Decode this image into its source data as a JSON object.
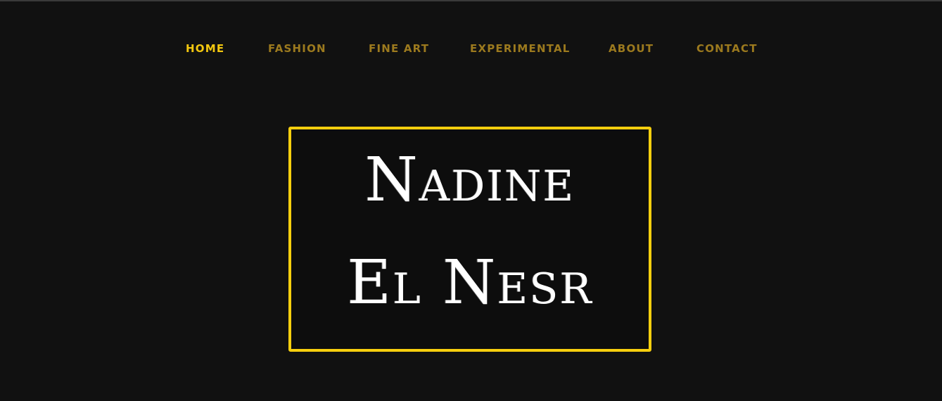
{
  "nav": {
    "items": [
      {
        "label": "HOME",
        "active": true
      },
      {
        "label": "FASHION",
        "active": false
      },
      {
        "label": "FINE ART",
        "active": false
      },
      {
        "label": "EXPERIMENTAL",
        "active": false
      },
      {
        "label": "ABOUT",
        "active": false
      },
      {
        "label": "CONTACT",
        "active": false
      }
    ]
  },
  "hero": {
    "line1": "Nadine",
    "line2": "El Nesr"
  },
  "colors": {
    "background": "#111111",
    "accent": "#f4c80f",
    "nav_inactive": "#9c7a1e",
    "title_text": "#ffffff",
    "box_border": "#f7cf0e"
  }
}
